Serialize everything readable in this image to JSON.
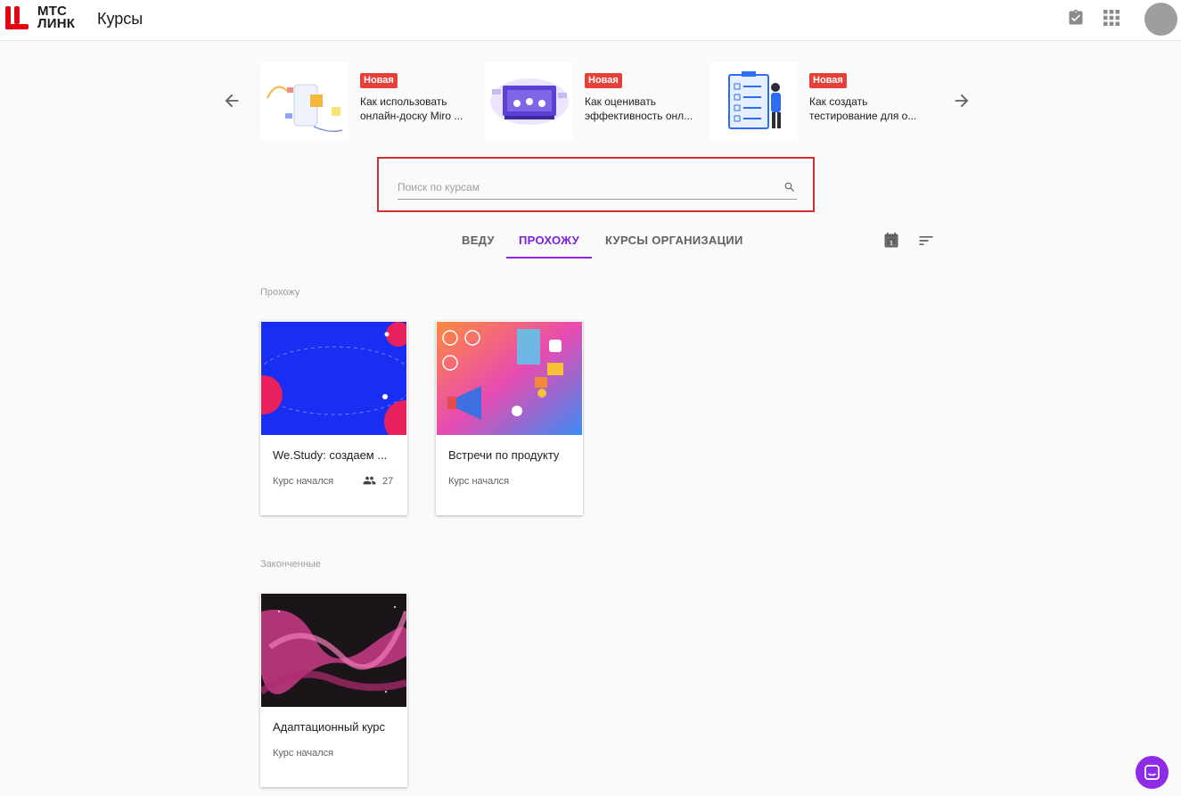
{
  "header": {
    "logo_line1": "МТС",
    "logo_line2": "ЛИНК",
    "title": "Курсы",
    "icons": [
      "clipboard-check-icon",
      "apps-grid-icon"
    ],
    "avatar_color": "#9e9e9e"
  },
  "carousel": {
    "items": [
      {
        "badge": "Новая",
        "title_line1": "Как использовать",
        "title_line2": "онлайн-доску Miro ..."
      },
      {
        "badge": "Новая",
        "title_line1": "Как оценивать",
        "title_line2": "эффективность онл..."
      },
      {
        "badge": "Новая",
        "title_line1": "Как создать",
        "title_line2": "тестирование для о..."
      }
    ]
  },
  "search": {
    "placeholder": "Поиск по курсам",
    "value": ""
  },
  "tabs": [
    {
      "label": "ВЕДУ",
      "active": false
    },
    {
      "label": "ПРОХОЖУ",
      "active": true
    },
    {
      "label": "КУРСЫ ОРГАНИЗАЦИИ",
      "active": false
    }
  ],
  "toolbar": {
    "calendar_day": "1",
    "icons": [
      "calendar-icon",
      "sort-icon"
    ]
  },
  "sections": [
    {
      "label": "Прохожу",
      "courses": [
        {
          "title": "We.Study: создаем ...",
          "status": "Курс начался",
          "participants": "27"
        },
        {
          "title": "Встречи по продукту",
          "status": "Курс начался"
        }
      ]
    },
    {
      "label": "Законченные",
      "courses": [
        {
          "title": "Адаптационный курс",
          "status": "Курс начался"
        }
      ]
    }
  ],
  "colors": {
    "accent": "#8e24e8",
    "badge": "#e5413a",
    "highlight_border": "#d32f2f",
    "logo_red": "#e30611"
  }
}
